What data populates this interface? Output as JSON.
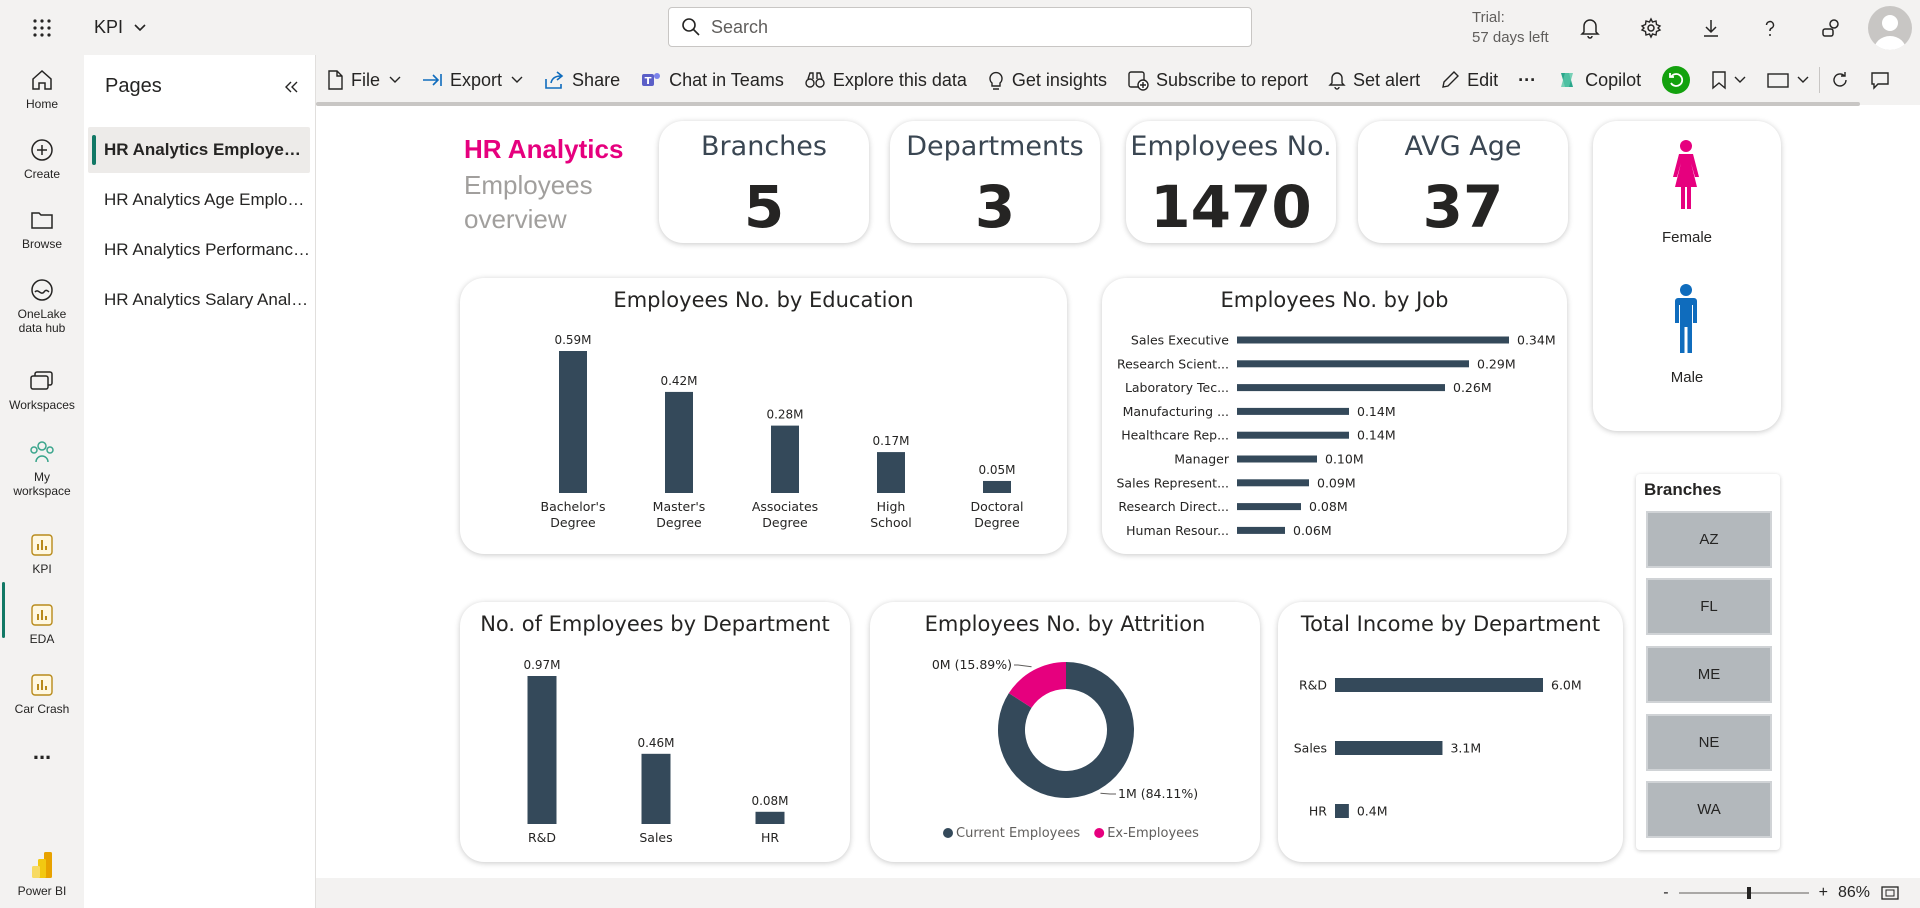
{
  "topbar": {
    "app_name": "KPI",
    "search_placeholder": "Search",
    "trial_line1": "Trial:",
    "trial_line2": "57 days left"
  },
  "nav": {
    "items": [
      {
        "label": "Home",
        "icon": "home-icon"
      },
      {
        "label": "Create",
        "icon": "plus-circle-icon"
      },
      {
        "label": "Browse",
        "icon": "folder-icon"
      },
      {
        "label": "OneLake data hub",
        "icon": "onelake-icon"
      },
      {
        "label": "Workspaces",
        "icon": "workspaces-icon"
      },
      {
        "label": "My workspace",
        "icon": "people-icon"
      },
      {
        "label": "KPI",
        "icon": "report-icon"
      },
      {
        "label": "EDA",
        "icon": "report-icon"
      },
      {
        "label": "Car Crash",
        "icon": "report-icon"
      }
    ],
    "more": "...",
    "brand": "Power BI"
  },
  "pages": {
    "title": "Pages",
    "items": [
      "HR Analytics Employees Overview",
      "HR Analytics Age Employees Analysis",
      "HR Analytics Performance Analysis",
      "HR Analytics Salary Analysis"
    ]
  },
  "toolbar": {
    "file": "File",
    "export": "Export",
    "share": "Share",
    "chat": "Chat in Teams",
    "explore": "Explore this data",
    "insights": "Get insights",
    "subscribe": "Subscribe to report",
    "alert": "Set alert",
    "edit": "Edit",
    "more": "···",
    "copilot": "Copilot"
  },
  "report": {
    "title": "HR Analytics",
    "subtitle": "Employees overview",
    "kpis": [
      {
        "label": "Branches",
        "value": "5"
      },
      {
        "label": "Departments",
        "value": "3"
      },
      {
        "label": "Employees No.",
        "value": "1470"
      },
      {
        "label": "AVG Age",
        "value": "37"
      }
    ],
    "gender": {
      "female": "Female",
      "male": "Male",
      "female_color": "#e6007e",
      "male_color": "#0f6cbd"
    },
    "slicer": {
      "title": "Branches",
      "items": [
        "AZ",
        "FL",
        "ME",
        "NE",
        "WA"
      ]
    },
    "bar_color": "#34495a",
    "accent_color": "#e6007e"
  },
  "status": {
    "zoom": "86%"
  },
  "chart_data": [
    {
      "type": "bar",
      "title": "Employees No. by Education",
      "categories": [
        "Bachelor's Degree",
        "Master's Degree",
        "Associates Degree",
        "High School",
        "Doctoral Degree"
      ],
      "values": [
        0.59,
        0.42,
        0.28,
        0.17,
        0.05
      ],
      "labels": [
        "0.59M",
        "0.42M",
        "0.28M",
        "0.17M",
        "0.05M"
      ],
      "ylim": [
        0,
        0.6
      ]
    },
    {
      "type": "bar",
      "orientation": "horizontal",
      "title": "Employees No. by Job",
      "categories": [
        "Sales Executive",
        "Research Scient...",
        "Laboratory Tec...",
        "Manufacturing ...",
        "Healthcare Rep...",
        "Manager",
        "Sales Represent...",
        "Research Direct...",
        "Human Resour..."
      ],
      "values": [
        0.34,
        0.29,
        0.26,
        0.14,
        0.14,
        0.1,
        0.09,
        0.08,
        0.06
      ],
      "labels": [
        "0.34M",
        "0.29M",
        "0.26M",
        "0.14M",
        "0.14M",
        "0.10M",
        "0.09M",
        "0.08M",
        "0.06M"
      ]
    },
    {
      "type": "bar",
      "title": "No. of Employees by Department",
      "categories": [
        "R&D",
        "Sales",
        "HR"
      ],
      "values": [
        0.97,
        0.46,
        0.08
      ],
      "labels": [
        "0.97M",
        "0.46M",
        "0.08M"
      ]
    },
    {
      "type": "pie",
      "title": "Employees No. by Attrition",
      "categories": [
        "Current Employees",
        "Ex-Employees"
      ],
      "values": [
        84.11,
        15.89
      ],
      "labels": [
        "1M (84.11%)",
        "0M (15.89%)"
      ],
      "colors": [
        "#34495a",
        "#e6007e"
      ]
    },
    {
      "type": "bar",
      "orientation": "horizontal",
      "title": "Total Income by Department",
      "categories": [
        "R&D",
        "Sales",
        "HR"
      ],
      "values": [
        6.0,
        3.1,
        0.4
      ],
      "labels": [
        "6.0M",
        "3.1M",
        "0.4M"
      ]
    }
  ]
}
